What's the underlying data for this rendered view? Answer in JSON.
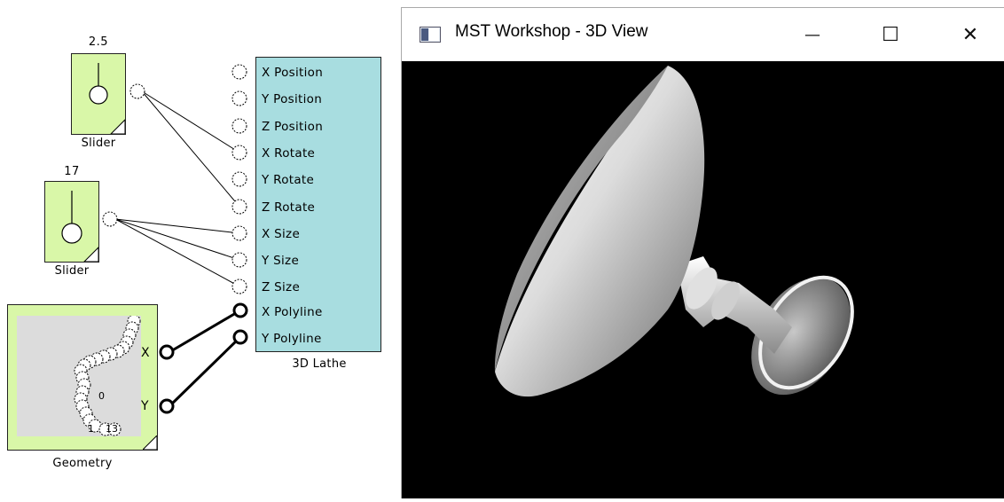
{
  "window": {
    "title": "MST Workshop - 3D View",
    "minimize_glyph": "—",
    "maximize_glyph": "☐",
    "close_glyph": "✕"
  },
  "blocks": {
    "slider1": {
      "value": "2.5",
      "label": "Slider"
    },
    "slider2": {
      "value": "17",
      "label": "Slider"
    },
    "lathe": {
      "label": "3D Lathe",
      "ports": [
        "X Position",
        "Y Position",
        "Z Position",
        "X Rotate",
        "Y Rotate",
        "Z Rotate",
        "X Size",
        "Y Size",
        "Z Size",
        "X Polyline",
        "Y Polyline"
      ]
    },
    "geometry": {
      "label": "Geometry",
      "output_x": "X",
      "output_y": "Y",
      "point_labels": [
        "1",
        "13",
        "0"
      ]
    }
  },
  "colors": {
    "slider_fill": "#d9f7a8",
    "lathe_fill": "#a8dde0",
    "viewport_bg": "#000000"
  }
}
